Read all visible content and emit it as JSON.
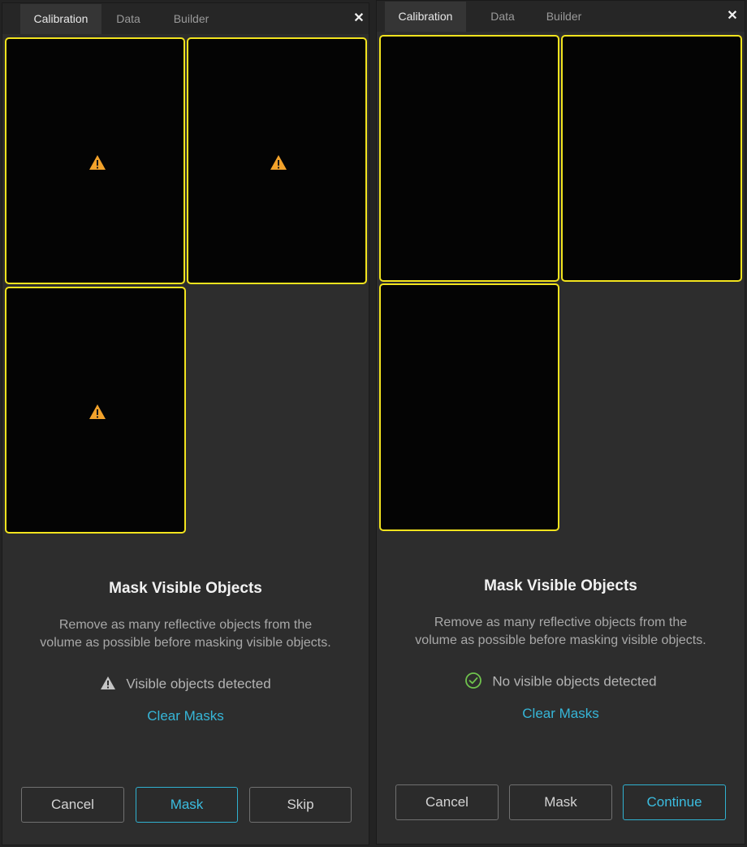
{
  "colors": {
    "accent": "#3bbde0",
    "camera_border": "#f2e31e",
    "warning": "#f2a22b",
    "success": "#6fc24d"
  },
  "left": {
    "tabs": [
      {
        "label": "Calibration",
        "active": true
      },
      {
        "label": "Data",
        "active": false
      },
      {
        "label": "Builder",
        "active": false
      }
    ],
    "close_glyph": "✕",
    "cameras": [
      {
        "status_icon": "warning-icon"
      },
      {
        "status_icon": "warning-icon"
      },
      {
        "status_icon": "warning-icon"
      }
    ],
    "title": "Mask Visible Objects",
    "description_line1": "Remove as many reflective objects from the",
    "description_line2": "volume as possible before masking visible objects.",
    "status_icon": "warning-icon",
    "status_text": "Visible objects detected",
    "clear_link": "Clear Masks",
    "buttons": {
      "cancel": "Cancel",
      "mask": "Mask",
      "skip": "Skip"
    }
  },
  "right": {
    "tabs": [
      {
        "label": "Calibration",
        "active": true
      },
      {
        "label": "Data",
        "active": false
      },
      {
        "label": "Builder",
        "active": false
      }
    ],
    "close_glyph": "✕",
    "title": "Mask Visible Objects",
    "description_line1": "Remove as many reflective objects from the",
    "description_line2": "volume as possible before masking visible objects.",
    "status_icon": "check-circle-icon",
    "status_text": "No visible objects detected",
    "clear_link": "Clear Masks",
    "buttons": {
      "cancel": "Cancel",
      "mask": "Mask",
      "continue": "Continue"
    }
  }
}
